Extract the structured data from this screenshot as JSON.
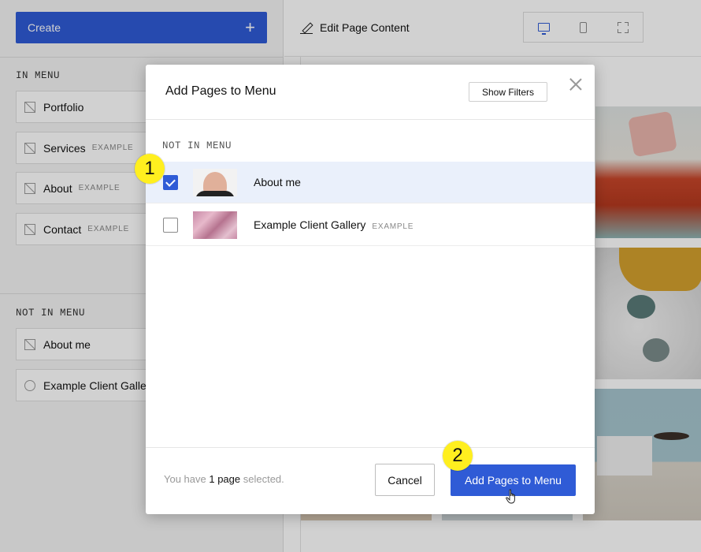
{
  "sidebar": {
    "create_label": "Create",
    "in_menu_label": "IN MENU",
    "not_in_menu_label": "NOT IN MENU",
    "in_menu_items": [
      {
        "label": "Portfolio",
        "tag": ""
      },
      {
        "label": "Services",
        "tag": "EXAMPLE"
      },
      {
        "label": "About",
        "tag": "EXAMPLE"
      },
      {
        "label": "Contact",
        "tag": "EXAMPLE"
      }
    ],
    "not_in_menu_items": [
      {
        "label": "About me"
      },
      {
        "label": "Example Client Gallery"
      }
    ]
  },
  "topbar": {
    "edit_label": "Edit Page Content"
  },
  "modal": {
    "title": "Add Pages to Menu",
    "show_filters_label": "Show Filters",
    "section_label": "NOT IN MENU",
    "rows": [
      {
        "title": "About me",
        "tag": "",
        "checked": true
      },
      {
        "title": "Example Client Gallery",
        "tag": "EXAMPLE",
        "checked": false
      }
    ],
    "footer": {
      "prefix": "You have ",
      "count": "1 page",
      "suffix": " selected."
    },
    "cancel_label": "Cancel",
    "add_label": "Add Pages to Menu"
  },
  "annotations": {
    "step1": "1",
    "step2": "2"
  },
  "colors": {
    "accent": "#2f5bd6",
    "badge": "#ffef1f",
    "selected_row": "#eaf0fb"
  }
}
